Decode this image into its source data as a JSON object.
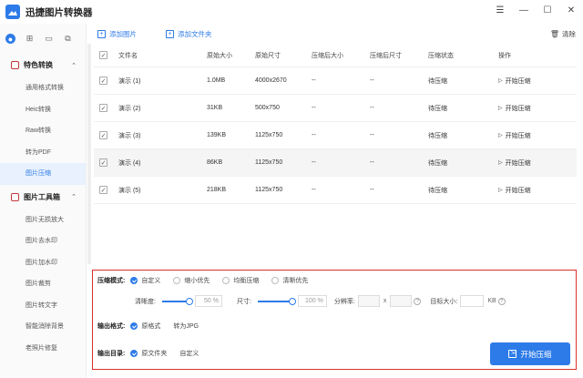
{
  "app": {
    "title": "迅捷图片转换器"
  },
  "window": {
    "icons": [
      "menu-icon",
      "minimize-icon",
      "maximize-icon",
      "close-icon"
    ]
  },
  "sidebar": {
    "groups": [
      {
        "label": "特色转换",
        "items": [
          "通用格式转换",
          "Heic转换",
          "Raw转换",
          "转为PDF",
          "图片压缩"
        ]
      },
      {
        "label": "图片工具箱",
        "items": [
          "图片无损放大",
          "图片去水印",
          "图片加水印",
          "图片裁剪",
          "图片转文字",
          "智能消除背景",
          "老照片修复"
        ]
      }
    ],
    "selected_item": "图片压缩"
  },
  "toolbar": {
    "add_image": "添加图片",
    "add_folder": "添加文件夹",
    "clear": "清除"
  },
  "table": {
    "headers": [
      "文件名",
      "原始大小",
      "原始尺寸",
      "压缩后大小",
      "压缩后尺寸",
      "压缩状态",
      "操作"
    ],
    "rows": [
      {
        "name": "演示 (1)",
        "size": "1.0MB",
        "dim": "4000x2670",
        "new_size": "--",
        "new_dim": "--",
        "status": "待压缩",
        "action": "开始压缩"
      },
      {
        "name": "演示 (2)",
        "size": "31KB",
        "dim": "500x750",
        "new_size": "--",
        "new_dim": "--",
        "status": "待压缩",
        "action": "开始压缩"
      },
      {
        "name": "演示 (3)",
        "size": "139KB",
        "dim": "1125x750",
        "new_size": "--",
        "new_dim": "--",
        "status": "待压缩",
        "action": "开始压缩"
      },
      {
        "name": "演示 (4)",
        "size": "86KB",
        "dim": "1125x750",
        "new_size": "--",
        "new_dim": "--",
        "status": "待压缩",
        "action": "开始压缩"
      },
      {
        "name": "演示 (5)",
        "size": "218KB",
        "dim": "1125x750",
        "new_size": "--",
        "new_dim": "--",
        "status": "待压缩",
        "action": "开始压缩"
      }
    ]
  },
  "settings": {
    "mode_label": "压缩模式:",
    "modes": [
      "自定义",
      "缩小优先",
      "均衡压缩",
      "清晰优先"
    ],
    "clarity_label": "清晰度:",
    "clarity_value": "50",
    "size_label": "尺寸:",
    "size_value": "100",
    "percent": "%",
    "resolution_label": "分辨率:",
    "x_sep": "x",
    "target_label": "目标大小:",
    "target_unit": "KB",
    "output_format_label": "输出格式:",
    "output_formats": [
      "原格式",
      "转为JPG"
    ],
    "output_dir_label": "输出目录:",
    "output_dirs": [
      "原文件夹",
      "自定义"
    ],
    "start_button": "开始压缩"
  },
  "colors": {
    "accent": "#2d7be8",
    "highlight_border": "#d9302c"
  }
}
